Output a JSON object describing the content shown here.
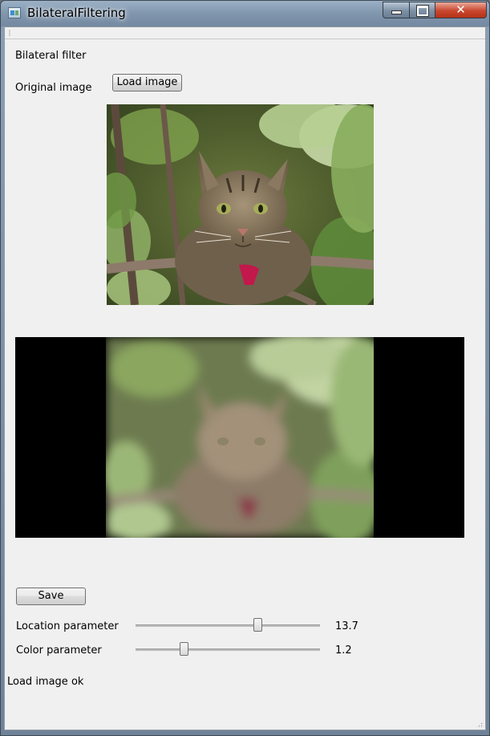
{
  "window": {
    "title": "BilateralFiltering"
  },
  "header": {
    "heading": "Bilateral filter"
  },
  "original": {
    "label": "Original image",
    "load_button": "Load image"
  },
  "controls": {
    "save_button": "Save",
    "location": {
      "label": "Location parameter",
      "value": "13.7",
      "slider_fraction": 0.67
    },
    "color": {
      "label": "Color parameter",
      "value": "1.2",
      "slider_fraction": 0.25
    }
  },
  "status": {
    "message": "Load image ok"
  },
  "colors": {
    "client_background": "#f0f0f0",
    "result_background": "#000000",
    "close_button": "#c9472d"
  },
  "icons": [
    "app-icon",
    "minimize-icon",
    "maximize-icon",
    "close-icon",
    "resize-grip-icon"
  ]
}
